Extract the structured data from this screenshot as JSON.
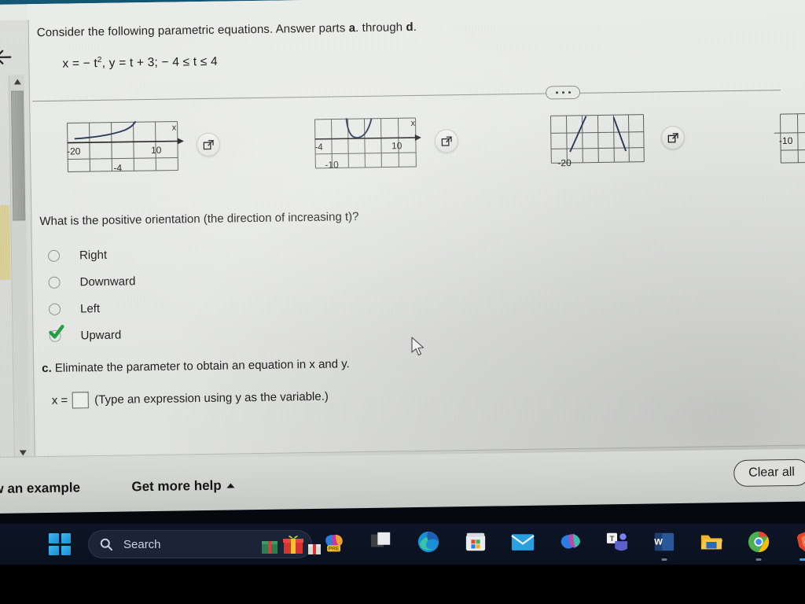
{
  "document": {
    "prompt_before": "Consider the following parametric equations. Answer parts ",
    "prompt_bold_a": "a",
    "prompt_middle": ". through ",
    "prompt_bold_d": "d",
    "prompt_end": ".",
    "equation": "x = − t², y = t + 3;  − 4 ≤ t ≤ 4",
    "eq_x_label": "x = − t",
    "eq_exponent": "2",
    "eq_rest": ", y = t + 3;  − 4 ≤ t ≤ 4",
    "question": "What is the positive orientation (the direction of increasing t)?",
    "part_c_bold": "c.",
    "part_c_text": " Eliminate the parameter to obtain an equation in x and y.",
    "answer_prefix": "x =",
    "answer_value": "",
    "answer_hint": "(Type an expression using y as the variable.)"
  },
  "options": [
    {
      "label": "Right",
      "selected": false
    },
    {
      "label": "Downward",
      "selected": false
    },
    {
      "label": "Left",
      "selected": false
    },
    {
      "label": "Upward",
      "selected": true
    }
  ],
  "graphs": [
    {
      "name": "graph-choice-a",
      "labels": [
        "-20",
        "10",
        "-4"
      ],
      "axis_label": "x",
      "curve": "increasing-concave-up"
    },
    {
      "name": "graph-choice-b",
      "labels": [
        "-4",
        "10",
        "-10"
      ],
      "axis_label": "x",
      "curve": "upward-parabola"
    },
    {
      "name": "graph-choice-c",
      "labels": [
        "-20"
      ],
      "axis_label": "",
      "curve": "two-steep-segments"
    },
    {
      "name": "graph-choice-d",
      "labels": [
        "-10"
      ],
      "axis_label": "",
      "curve": "partial-offscreen"
    }
  ],
  "divider": {
    "more_dots": "•••"
  },
  "toolbar": {
    "view_example": "w an example",
    "get_more_help": "Get more help",
    "clear_all": "Clear all"
  },
  "taskbar": {
    "search_placeholder": "Search",
    "icons": [
      {
        "name": "windows-start-icon"
      },
      {
        "name": "search-icon"
      },
      {
        "name": "gift-icon"
      },
      {
        "name": "copilot-pre-icon",
        "badge": "PRE"
      },
      {
        "name": "task-view-icon"
      },
      {
        "name": "edge-browser-icon"
      },
      {
        "name": "microsoft-store-icon"
      },
      {
        "name": "mail-icon"
      },
      {
        "name": "copilot-icon"
      },
      {
        "name": "teams-icon"
      },
      {
        "name": "word-icon"
      },
      {
        "name": "file-explorer-icon"
      },
      {
        "name": "chrome-icon"
      },
      {
        "name": "brave-browser-icon"
      }
    ]
  },
  "colors": {
    "top_band": "#115b78",
    "page_bg": "#e9ebe8",
    "check_green": "#1f9d3f",
    "taskbar_bg": "#0d1526",
    "sticky_note": "#d9cf91"
  }
}
